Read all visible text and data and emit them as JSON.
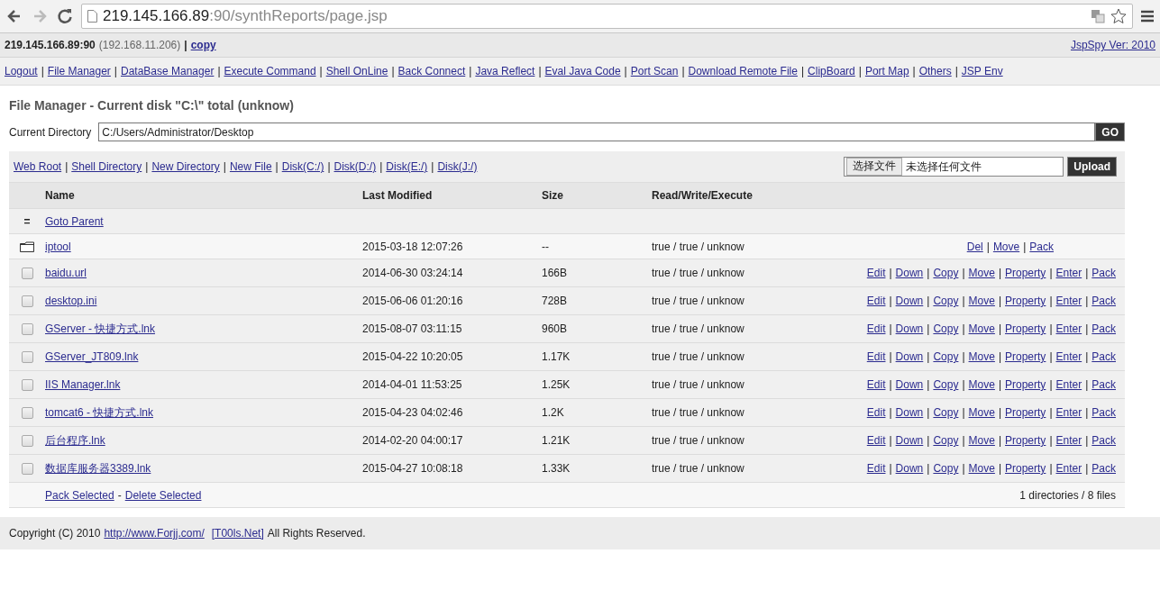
{
  "browser": {
    "url_host": "219.145.166.89",
    "url_path": ":90/synthReports/page.jsp"
  },
  "info_bar": {
    "host": "219.145.166.89:90",
    "local_ip": "(192.168.11.206)",
    "separator": "|",
    "copy_link": "copy",
    "version_link": "JspSpy Ver: 2010"
  },
  "nav": {
    "separator": "|",
    "links": [
      "Logout",
      "File Manager",
      "DataBase Manager",
      "Execute Command",
      "Shell OnLine",
      "Back Connect",
      "Java Reflect",
      "Eval Java Code",
      "Port Scan",
      "Download Remote File",
      "ClipBoard",
      "Port Map",
      "Others",
      "JSP Env"
    ]
  },
  "title": "File Manager - Current disk \"C:\\\" total (unknow)",
  "directory": {
    "label": "Current Directory",
    "value": "C:/Users/Administrator/Desktop",
    "go_button": "GO"
  },
  "shortcuts": {
    "separator": "|",
    "links": [
      "Web Root",
      "Shell Directory",
      "New Directory",
      "New File",
      "Disk(C:/)",
      "Disk(D:/)",
      "Disk(E:/)",
      "Disk(J:/)"
    ]
  },
  "upload": {
    "choose_button": "选择文件",
    "file_status": "未选择任何文件",
    "upload_button": "Upload"
  },
  "table": {
    "columns": [
      "Name",
      "Last Modified",
      "Size",
      "Read/Write/Execute"
    ],
    "action_separator": "|",
    "rows": [
      {
        "kind": "parent",
        "marker": "=",
        "name": "Goto Parent"
      },
      {
        "kind": "folder",
        "name": "iptool",
        "modified": "2015-03-18 12:07:26",
        "size": "--",
        "rwx": "true / true / unknow",
        "actions": [
          "Del",
          "Move",
          "Pack"
        ]
      },
      {
        "kind": "file",
        "checked": false,
        "name": "baidu.url",
        "modified": "2014-06-30 03:24:14",
        "size": "166B",
        "rwx": "true / true / unknow",
        "actions": [
          "Edit",
          "Down",
          "Copy",
          "Move",
          "Property",
          "Enter",
          "Pack"
        ]
      },
      {
        "kind": "file",
        "checked": false,
        "name": "desktop.ini",
        "modified": "2015-06-06 01:20:16",
        "size": "728B",
        "rwx": "true / true / unknow",
        "actions": [
          "Edit",
          "Down",
          "Copy",
          "Move",
          "Property",
          "Enter",
          "Pack"
        ]
      },
      {
        "kind": "file",
        "checked": false,
        "name": "GServer - 快捷方式.lnk",
        "modified": "2015-08-07 03:11:15",
        "size": "960B",
        "rwx": "true / true / unknow",
        "actions": [
          "Edit",
          "Down",
          "Copy",
          "Move",
          "Property",
          "Enter",
          "Pack"
        ]
      },
      {
        "kind": "file",
        "checked": false,
        "name": "GServer_JT809.lnk",
        "modified": "2015-04-22 10:20:05",
        "size": "1.17K",
        "rwx": "true / true / unknow",
        "actions": [
          "Edit",
          "Down",
          "Copy",
          "Move",
          "Property",
          "Enter",
          "Pack"
        ]
      },
      {
        "kind": "file",
        "checked": false,
        "name": "IIS Manager.lnk",
        "modified": "2014-04-01 11:53:25",
        "size": "1.25K",
        "rwx": "true / true / unknow",
        "actions": [
          "Edit",
          "Down",
          "Copy",
          "Move",
          "Property",
          "Enter",
          "Pack"
        ]
      },
      {
        "kind": "file",
        "checked": false,
        "name": "tomcat6 - 快捷方式.lnk",
        "modified": "2015-04-23 04:02:46",
        "size": "1.2K",
        "rwx": "true / true / unknow",
        "actions": [
          "Edit",
          "Down",
          "Copy",
          "Move",
          "Property",
          "Enter",
          "Pack"
        ]
      },
      {
        "kind": "file",
        "checked": false,
        "name": "后台程序.lnk",
        "modified": "2014-02-20 04:00:17",
        "size": "1.21K",
        "rwx": "true / true / unknow",
        "actions": [
          "Edit",
          "Down",
          "Copy",
          "Move",
          "Property",
          "Enter",
          "Pack"
        ]
      },
      {
        "kind": "file",
        "checked": false,
        "name": "数据库服务器3389.lnk",
        "modified": "2015-04-27 10:08:18",
        "size": "1.33K",
        "rwx": "true / true / unknow",
        "actions": [
          "Edit",
          "Down",
          "Copy",
          "Move",
          "Property",
          "Enter",
          "Pack"
        ]
      }
    ],
    "footer": {
      "pack_link": "Pack Selected",
      "separator": "-",
      "delete_link": "Delete Selected",
      "summary": "1 directories / 8 files"
    }
  },
  "page_footer": {
    "text_before": "Copyright (C) 2010",
    "site_link": "http://www.Forjj.com/",
    "tools_link": "[T00ls.Net]",
    "text_after": "All Rights Reserved."
  }
}
